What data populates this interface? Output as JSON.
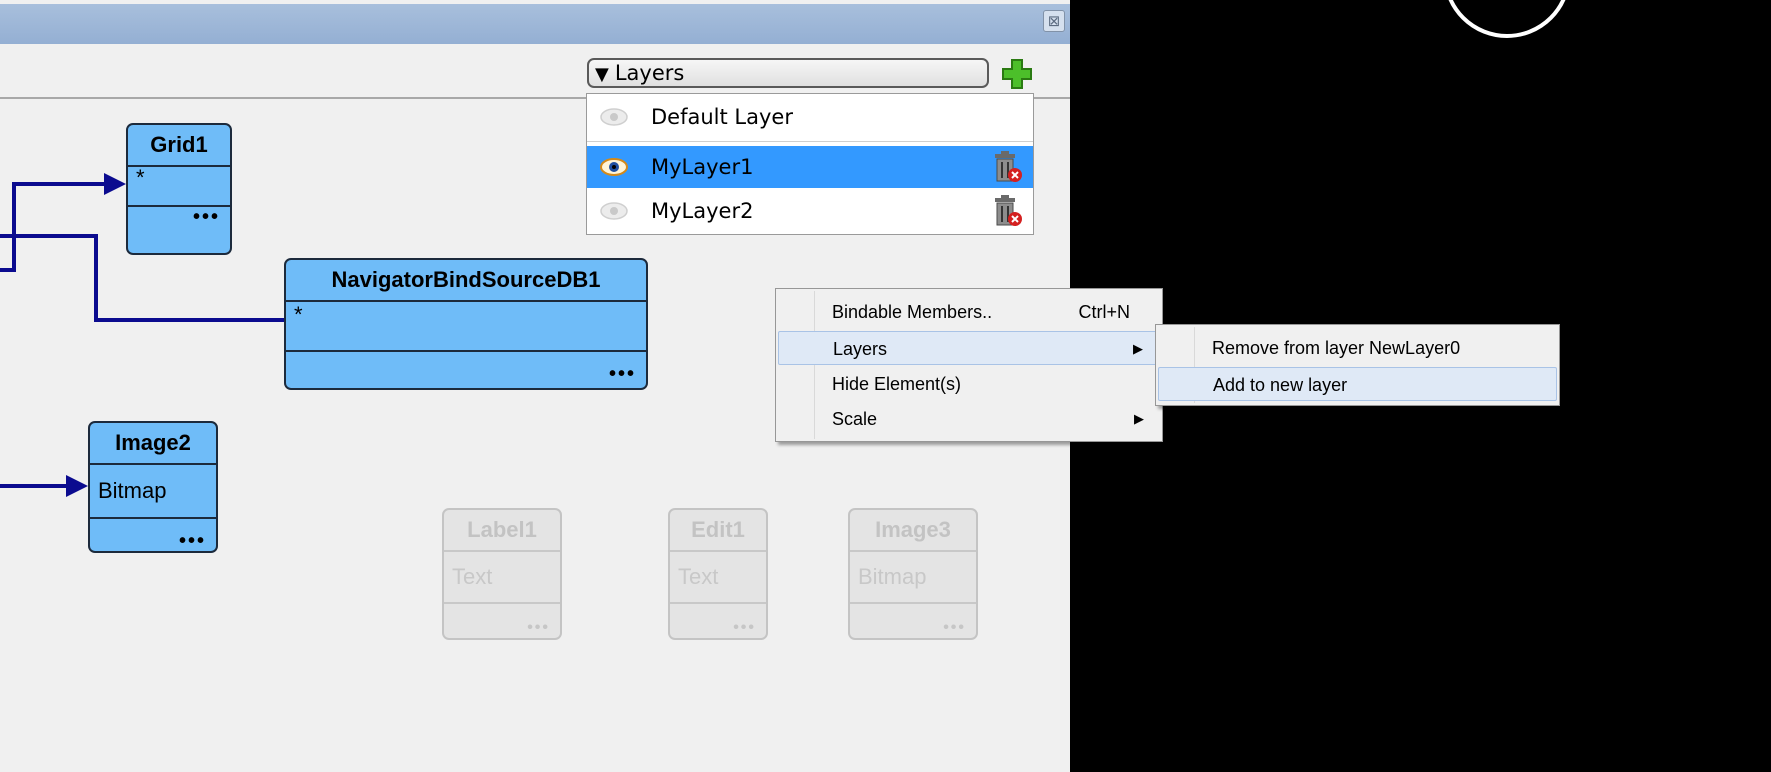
{
  "window": {
    "close_icon": "close-icon",
    "close_glyph": "⊠"
  },
  "nodes": {
    "grid1": {
      "title": "Grid1",
      "field": "*",
      "more": "•••"
    },
    "navigator": {
      "title": "NavigatorBindSourceDB1",
      "field": "*",
      "more": "•••"
    },
    "image2": {
      "title": "Image2",
      "field": "Bitmap",
      "more": "•••"
    },
    "label1": {
      "title": "Label1",
      "field": "Text",
      "more": "•••"
    },
    "edit1": {
      "title": "Edit1",
      "field": "Text",
      "more": "•••"
    },
    "image3": {
      "title": "Image3",
      "field": "Bitmap",
      "more": "•••"
    }
  },
  "layers_panel": {
    "dropdown_arrow": "▼",
    "dropdown_label": "Layers",
    "add_icon": "plus-icon",
    "items": [
      {
        "label": "Default Layer",
        "visible": false,
        "selected": false,
        "deletable": false
      },
      {
        "label": "MyLayer1",
        "visible": true,
        "selected": true,
        "deletable": true
      },
      {
        "label": "MyLayer2",
        "visible": false,
        "selected": false,
        "deletable": true
      }
    ]
  },
  "context_menu": {
    "items": [
      {
        "label": "Bindable Members..",
        "shortcut": "Ctrl+N",
        "submenu": false
      },
      {
        "label": "Layers",
        "shortcut": "",
        "submenu": true,
        "arrow": "▶"
      },
      {
        "label": "Hide Element(s)",
        "shortcut": "",
        "submenu": false
      },
      {
        "label": "Scale",
        "shortcut": "",
        "submenu": true,
        "arrow": "▶"
      }
    ]
  },
  "submenu": {
    "items": [
      {
        "label": "Remove from layer NewLayer0"
      },
      {
        "label": "Add to new layer"
      }
    ]
  },
  "colors": {
    "node_fill": "#6fbcf8",
    "connector": "#0b0b8f",
    "selection": "#3399ff",
    "titlebar": "#94afd3"
  }
}
